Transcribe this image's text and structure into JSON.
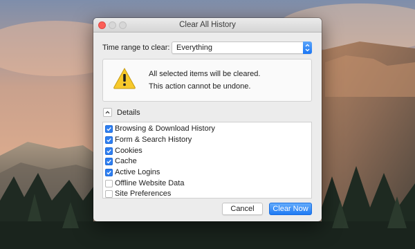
{
  "dialog": {
    "title": "Clear All History",
    "time_range_label": "Time range to clear:",
    "time_range_value": "Everything",
    "warning_line1": "All selected items will be cleared.",
    "warning_line2": "This action cannot be undone.",
    "details_label": "Details",
    "items": [
      {
        "label": "Browsing & Download History",
        "checked": true
      },
      {
        "label": "Form & Search History",
        "checked": true
      },
      {
        "label": "Cookies",
        "checked": true
      },
      {
        "label": "Cache",
        "checked": true
      },
      {
        "label": "Active Logins",
        "checked": true
      },
      {
        "label": "Offline Website Data",
        "checked": false
      },
      {
        "label": "Site Preferences",
        "checked": false
      }
    ],
    "cancel_label": "Cancel",
    "clear_label": "Clear Now"
  },
  "icons": {
    "warning": "warning-icon",
    "details_toggle": "chevron-up-icon",
    "stepper": "chevron-updown-icon",
    "check": "checkmark-icon"
  },
  "colors": {
    "accent": "#1f7af4",
    "close_button": "#fc5f57",
    "warning_yellow": "#f7c92b"
  }
}
